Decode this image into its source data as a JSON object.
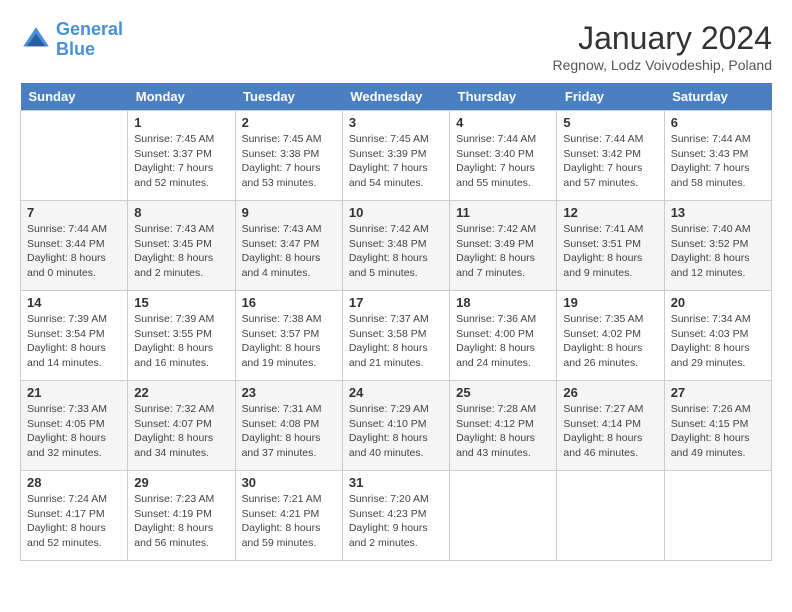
{
  "header": {
    "logo_line1": "General",
    "logo_line2": "Blue",
    "month": "January 2024",
    "location": "Regnow, Lodz Voivodeship, Poland"
  },
  "weekdays": [
    "Sunday",
    "Monday",
    "Tuesday",
    "Wednesday",
    "Thursday",
    "Friday",
    "Saturday"
  ],
  "weeks": [
    [
      {
        "day": "",
        "info": ""
      },
      {
        "day": "1",
        "info": "Sunrise: 7:45 AM\nSunset: 3:37 PM\nDaylight: 7 hours\nand 52 minutes."
      },
      {
        "day": "2",
        "info": "Sunrise: 7:45 AM\nSunset: 3:38 PM\nDaylight: 7 hours\nand 53 minutes."
      },
      {
        "day": "3",
        "info": "Sunrise: 7:45 AM\nSunset: 3:39 PM\nDaylight: 7 hours\nand 54 minutes."
      },
      {
        "day": "4",
        "info": "Sunrise: 7:44 AM\nSunset: 3:40 PM\nDaylight: 7 hours\nand 55 minutes."
      },
      {
        "day": "5",
        "info": "Sunrise: 7:44 AM\nSunset: 3:42 PM\nDaylight: 7 hours\nand 57 minutes."
      },
      {
        "day": "6",
        "info": "Sunrise: 7:44 AM\nSunset: 3:43 PM\nDaylight: 7 hours\nand 58 minutes."
      }
    ],
    [
      {
        "day": "7",
        "info": "Sunrise: 7:44 AM\nSunset: 3:44 PM\nDaylight: 8 hours\nand 0 minutes."
      },
      {
        "day": "8",
        "info": "Sunrise: 7:43 AM\nSunset: 3:45 PM\nDaylight: 8 hours\nand 2 minutes."
      },
      {
        "day": "9",
        "info": "Sunrise: 7:43 AM\nSunset: 3:47 PM\nDaylight: 8 hours\nand 4 minutes."
      },
      {
        "day": "10",
        "info": "Sunrise: 7:42 AM\nSunset: 3:48 PM\nDaylight: 8 hours\nand 5 minutes."
      },
      {
        "day": "11",
        "info": "Sunrise: 7:42 AM\nSunset: 3:49 PM\nDaylight: 8 hours\nand 7 minutes."
      },
      {
        "day": "12",
        "info": "Sunrise: 7:41 AM\nSunset: 3:51 PM\nDaylight: 8 hours\nand 9 minutes."
      },
      {
        "day": "13",
        "info": "Sunrise: 7:40 AM\nSunset: 3:52 PM\nDaylight: 8 hours\nand 12 minutes."
      }
    ],
    [
      {
        "day": "14",
        "info": "Sunrise: 7:39 AM\nSunset: 3:54 PM\nDaylight: 8 hours\nand 14 minutes."
      },
      {
        "day": "15",
        "info": "Sunrise: 7:39 AM\nSunset: 3:55 PM\nDaylight: 8 hours\nand 16 minutes."
      },
      {
        "day": "16",
        "info": "Sunrise: 7:38 AM\nSunset: 3:57 PM\nDaylight: 8 hours\nand 19 minutes."
      },
      {
        "day": "17",
        "info": "Sunrise: 7:37 AM\nSunset: 3:58 PM\nDaylight: 8 hours\nand 21 minutes."
      },
      {
        "day": "18",
        "info": "Sunrise: 7:36 AM\nSunset: 4:00 PM\nDaylight: 8 hours\nand 24 minutes."
      },
      {
        "day": "19",
        "info": "Sunrise: 7:35 AM\nSunset: 4:02 PM\nDaylight: 8 hours\nand 26 minutes."
      },
      {
        "day": "20",
        "info": "Sunrise: 7:34 AM\nSunset: 4:03 PM\nDaylight: 8 hours\nand 29 minutes."
      }
    ],
    [
      {
        "day": "21",
        "info": "Sunrise: 7:33 AM\nSunset: 4:05 PM\nDaylight: 8 hours\nand 32 minutes."
      },
      {
        "day": "22",
        "info": "Sunrise: 7:32 AM\nSunset: 4:07 PM\nDaylight: 8 hours\nand 34 minutes."
      },
      {
        "day": "23",
        "info": "Sunrise: 7:31 AM\nSunset: 4:08 PM\nDaylight: 8 hours\nand 37 minutes."
      },
      {
        "day": "24",
        "info": "Sunrise: 7:29 AM\nSunset: 4:10 PM\nDaylight: 8 hours\nand 40 minutes."
      },
      {
        "day": "25",
        "info": "Sunrise: 7:28 AM\nSunset: 4:12 PM\nDaylight: 8 hours\nand 43 minutes."
      },
      {
        "day": "26",
        "info": "Sunrise: 7:27 AM\nSunset: 4:14 PM\nDaylight: 8 hours\nand 46 minutes."
      },
      {
        "day": "27",
        "info": "Sunrise: 7:26 AM\nSunset: 4:15 PM\nDaylight: 8 hours\nand 49 minutes."
      }
    ],
    [
      {
        "day": "28",
        "info": "Sunrise: 7:24 AM\nSunset: 4:17 PM\nDaylight: 8 hours\nand 52 minutes."
      },
      {
        "day": "29",
        "info": "Sunrise: 7:23 AM\nSunset: 4:19 PM\nDaylight: 8 hours\nand 56 minutes."
      },
      {
        "day": "30",
        "info": "Sunrise: 7:21 AM\nSunset: 4:21 PM\nDaylight: 8 hours\nand 59 minutes."
      },
      {
        "day": "31",
        "info": "Sunrise: 7:20 AM\nSunset: 4:23 PM\nDaylight: 9 hours\nand 2 minutes."
      },
      {
        "day": "",
        "info": ""
      },
      {
        "day": "",
        "info": ""
      },
      {
        "day": "",
        "info": ""
      }
    ]
  ]
}
